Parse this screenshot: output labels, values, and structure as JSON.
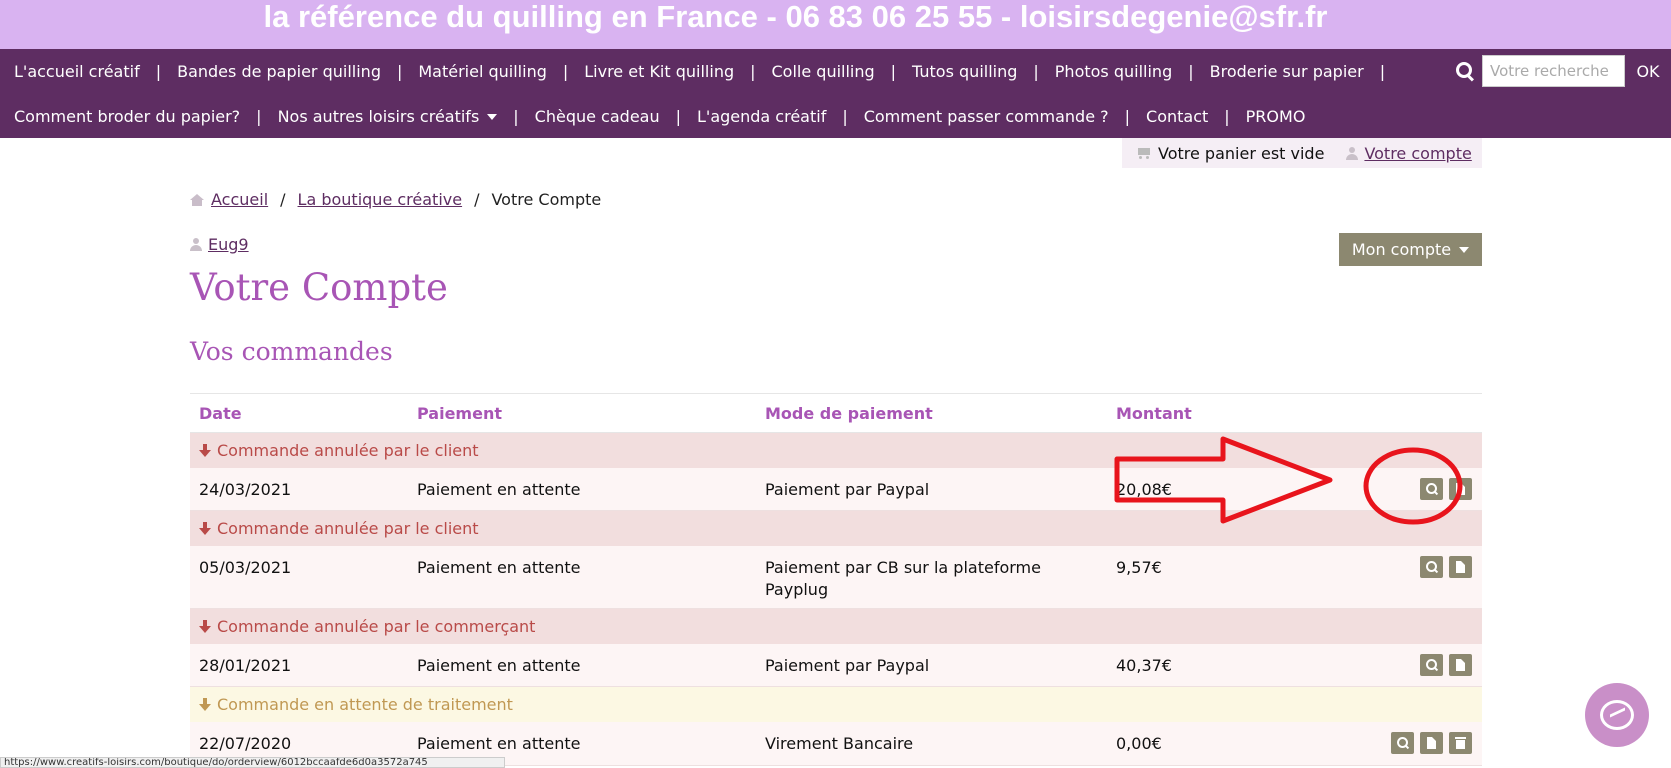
{
  "banner": {
    "text": "la référence du quilling en France - 06 83 06 25 55 - loisirsdegenie@sfr.fr"
  },
  "nav": {
    "row1": [
      "L'accueil créatif",
      "Bandes de papier quilling",
      "Matériel quilling",
      "Livre et Kit quilling",
      "Colle quilling",
      "Tutos quilling",
      "Photos quilling",
      "Broderie sur papier"
    ],
    "row2": [
      "Comment broder du papier?",
      "Nos autres loisirs créatifs",
      "Chèque cadeau",
      "L'agenda créatif",
      "Comment passer commande ?",
      "Contact",
      "PROMO"
    ],
    "separator": "|"
  },
  "search": {
    "placeholder": "Votre recherche",
    "ok_label": "OK"
  },
  "cart": {
    "text": "Votre panier est vide",
    "account_label": "Votre compte"
  },
  "breadcrumb": {
    "home": "Accueil",
    "shop": "La boutique créative",
    "current": "Votre Compte",
    "sep": "/"
  },
  "user": {
    "name": "Eug9"
  },
  "account_menu": {
    "label": "Mon compte"
  },
  "page": {
    "title": "Votre Compte",
    "subtitle": "Vos commandes"
  },
  "orders_table": {
    "headers": {
      "date": "Date",
      "payment": "Paiement",
      "mode": "Mode de paiement",
      "amount": "Montant"
    },
    "orders": [
      {
        "status": "Commande annulée par le client",
        "date": "24/03/2021",
        "payment": "Paiement en attente",
        "mode": "Paiement par Paypal",
        "amount": "20,08€"
      },
      {
        "status": "Commande annulée par le client",
        "date": "05/03/2021",
        "payment": "Paiement en attente",
        "mode": "Paiement par CB sur la plateforme Payplug",
        "amount": "9,57€"
      },
      {
        "status": "Commande annulée par le commerçant",
        "date": "28/01/2021",
        "payment": "Paiement en attente",
        "mode": "Paiement par Paypal",
        "amount": "40,37€"
      },
      {
        "status": "Commande en attente de traitement",
        "date": "22/07/2020",
        "payment": "Paiement en attente",
        "mode": "Virement Bancaire",
        "amount": "0,00€"
      }
    ]
  },
  "statusbar": {
    "url": "https://www.creatifs-loisirs.com/boutique/do/orderview/6012bccaafde6d0a3572a745"
  },
  "colors": {
    "banner": "#d9b3f1",
    "nav": "#5e2d62",
    "heading": "#a855b5",
    "button": "#8c8870",
    "cancelled_row": "#f2dede",
    "pending_row": "#fcf8e3",
    "annotation": "#e8141c"
  },
  "icons": {
    "search": "search-icon",
    "cart": "cart-icon",
    "user": "user-icon",
    "home": "home-icon",
    "view": "magnifier-icon",
    "invoice": "document-icon",
    "delete": "trash-icon",
    "status": "arrow-down-icon",
    "chat": "messenger-icon"
  }
}
